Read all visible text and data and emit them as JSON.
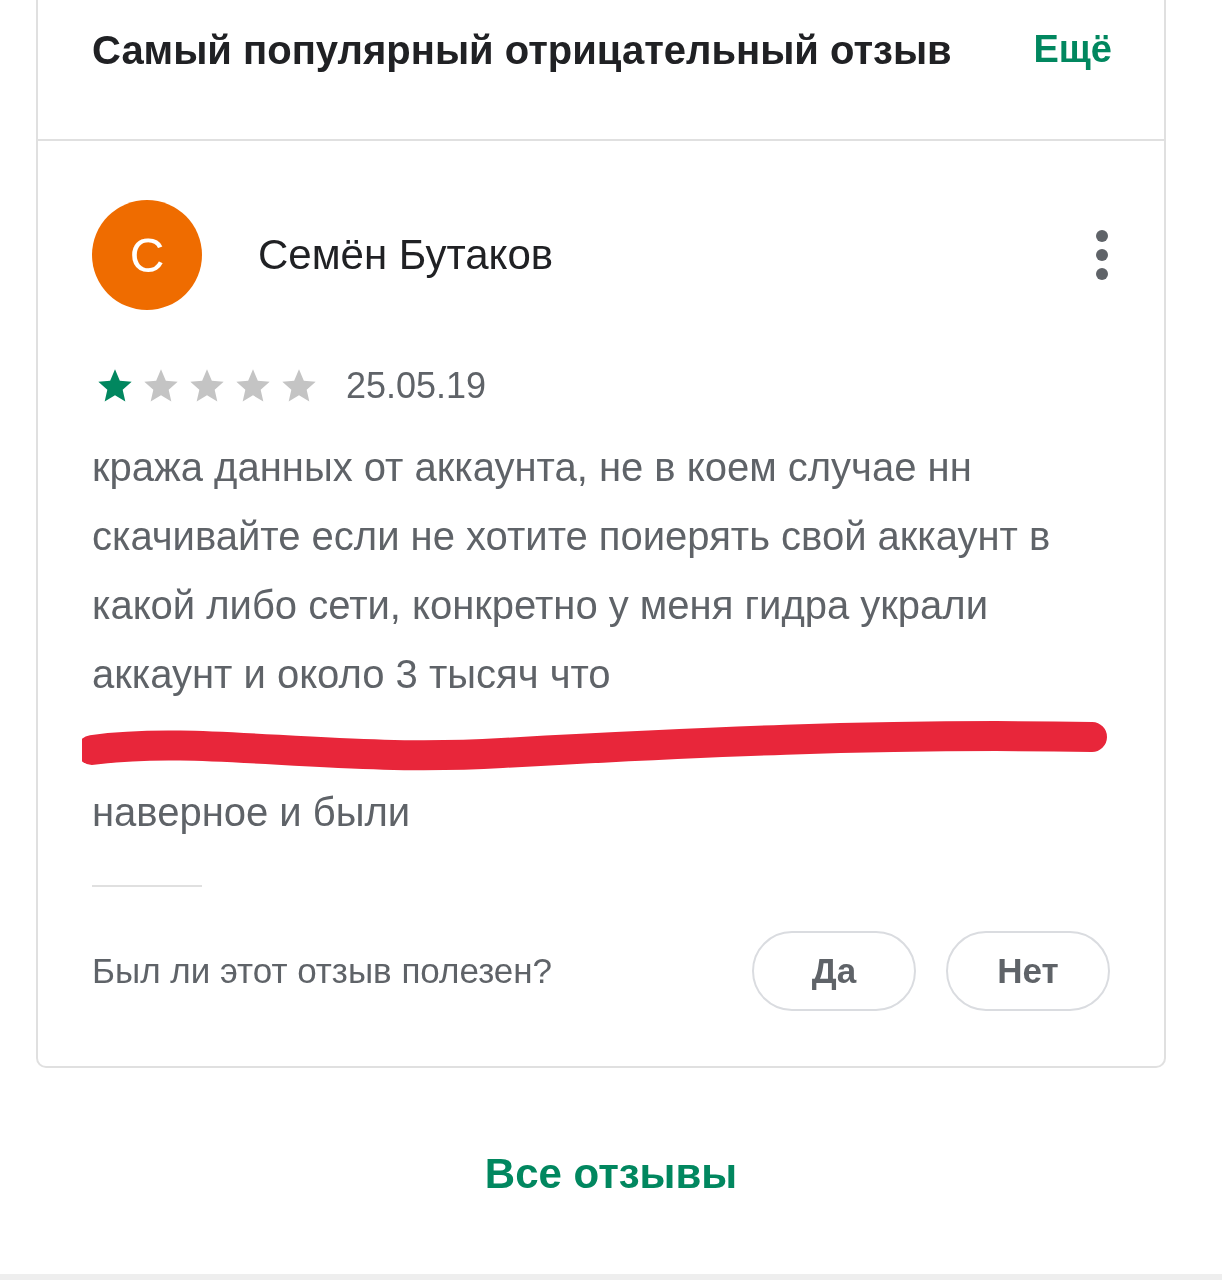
{
  "section": {
    "title": "Самый популярный отрицательный отзыв",
    "more_link": "Ещё"
  },
  "review": {
    "avatar_letter": "С",
    "author": "Семён Бутаков",
    "stars": 1,
    "date": "25.05.19",
    "text": "кража данных от аккаунта, не в коем случае нн скачивайте если не хотите поиерять свой аккаунт в какой либо сети, конкретно у меня гидра украли аккаунт и около 3 тысяч что",
    "redacted": true,
    "text_end": "наверное и были",
    "helpful_question": "Был ли этот отзыв полезен?",
    "buttons": [
      "Да",
      "Нет"
    ]
  },
  "all_reviews_link": "Все отзывы"
}
